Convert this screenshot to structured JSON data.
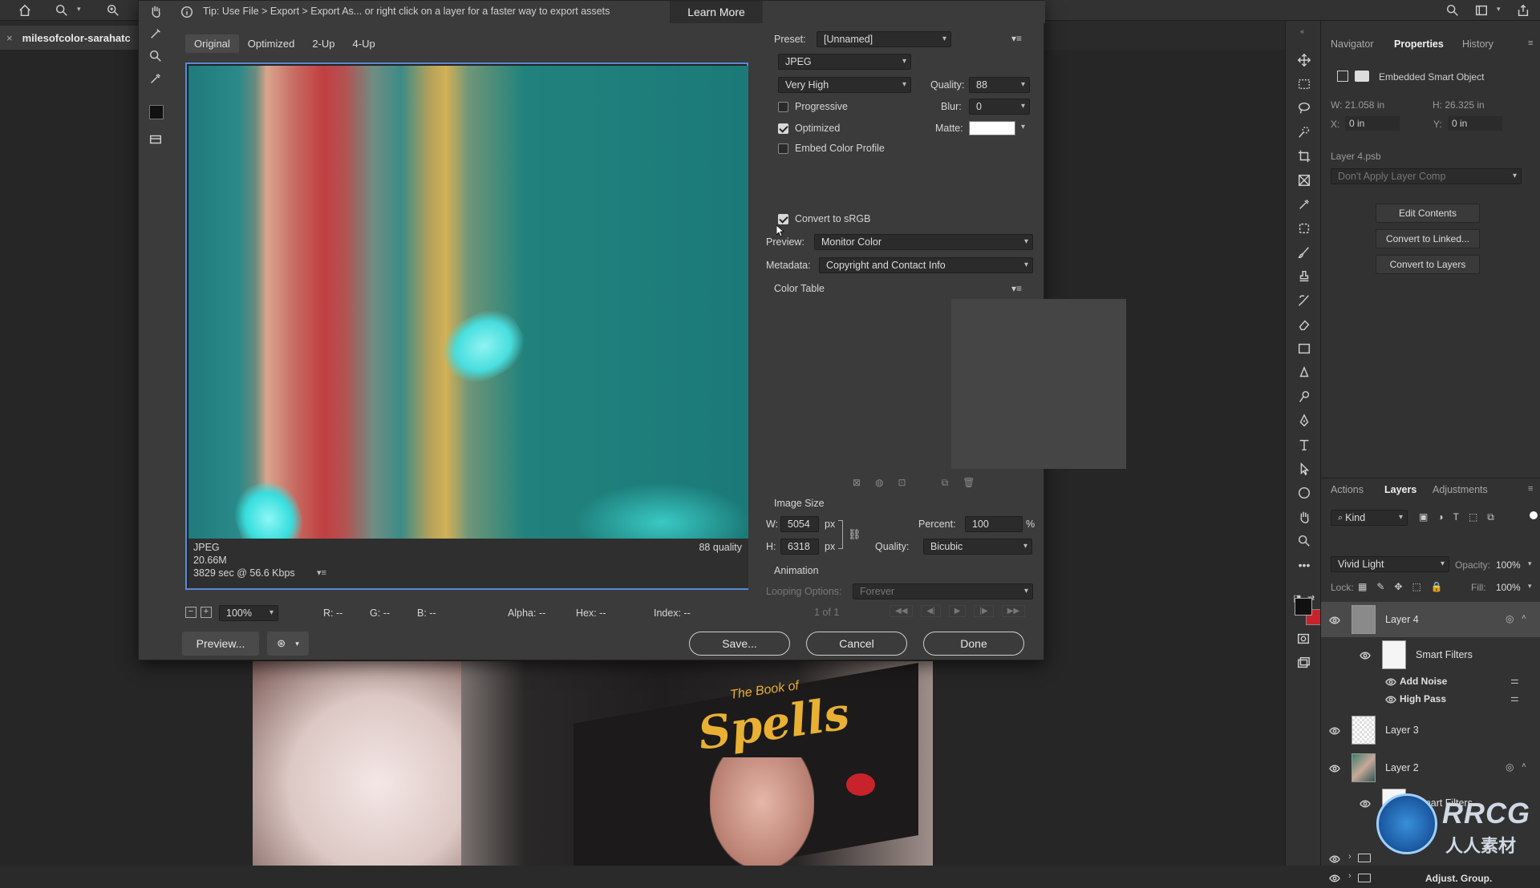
{
  "app": {
    "document_tab": "milesofcolor-sarahatc",
    "close_glyph": "×"
  },
  "tip": {
    "text": "Tip: Use File > Export > Export As... or right click on a layer for a faster way to export assets",
    "learn_more": "Learn More"
  },
  "view_tabs": [
    "Original",
    "Optimized",
    "2-Up",
    "4-Up"
  ],
  "preview": {
    "format": "JPEG",
    "size": "20.66M",
    "time": "3829 sec @ 56.6 Kbps",
    "quality_label": "88 quality"
  },
  "status": {
    "zoom": "100%",
    "r": "R: --",
    "g": "G: --",
    "b": "B: --",
    "alpha": "Alpha: --",
    "hex": "Hex: --",
    "index": "Index: --"
  },
  "buttons": {
    "preview": "Preview...",
    "save": "Save...",
    "cancel": "Cancel",
    "done": "Done"
  },
  "settings": {
    "preset_label": "Preset:",
    "preset_value": "[Unnamed]",
    "format": "JPEG",
    "quality_preset": "Very High",
    "quality_label": "Quality:",
    "quality_value": "88",
    "progressive": "Progressive",
    "blur_label": "Blur:",
    "blur_value": "0",
    "optimized": "Optimized",
    "matte_label": "Matte:",
    "embed_profile": "Embed Color Profile",
    "convert_srgb": "Convert to sRGB",
    "preview_label": "Preview:",
    "preview_value": "Monitor Color",
    "metadata_label": "Metadata:",
    "metadata_value": "Copyright and Contact Info",
    "color_table": "Color Table",
    "image_size": "Image Size",
    "w_label": "W:",
    "w_value": "5054",
    "h_label": "H:",
    "h_value": "6318",
    "px": "px",
    "percent_label": "Percent:",
    "percent_value": "100",
    "percent_sign": "%",
    "resample_label": "Quality:",
    "resample_value": "Bicubic",
    "animation": "Animation",
    "looping_label": "Looping Options:",
    "looping_value": "Forever",
    "frame": "1 of 1"
  },
  "properties": {
    "tabs": [
      "Navigator",
      "Properties",
      "History"
    ],
    "type": "Embedded Smart Object",
    "w": "W: 21.058 in",
    "h": "H: 26.325 in",
    "x_label": "X:",
    "x_value": "0 in",
    "y_label": "Y:",
    "y_value": "0 in",
    "file": "Layer 4.psb",
    "layer_comp": "Don't Apply Layer Comp",
    "edit_contents": "Edit Contents",
    "convert_linked": "Convert to Linked...",
    "convert_layers": "Convert to Layers"
  },
  "layers": {
    "tabs": [
      "Actions",
      "Layers",
      "Adjustments"
    ],
    "kind": "Kind",
    "blend": "Vivid Light",
    "opacity_label": "Opacity:",
    "opacity_value": "100%",
    "lock_label": "Lock:",
    "fill_label": "Fill:",
    "fill_value": "100%",
    "items": [
      {
        "name": "Layer 4"
      },
      {
        "name": "Smart Filters"
      },
      {
        "name": "Add Noise"
      },
      {
        "name": "High Pass"
      },
      {
        "name": "Layer 3"
      },
      {
        "name": "Layer 2"
      },
      {
        "name": "Smart Filters"
      },
      {
        "name": "Adjust. Group."
      }
    ]
  },
  "photo": {
    "book_small": "The Book of",
    "book_title": "Spells"
  },
  "watermark": {
    "brand": "RRCG",
    "sub": "人人素材"
  }
}
